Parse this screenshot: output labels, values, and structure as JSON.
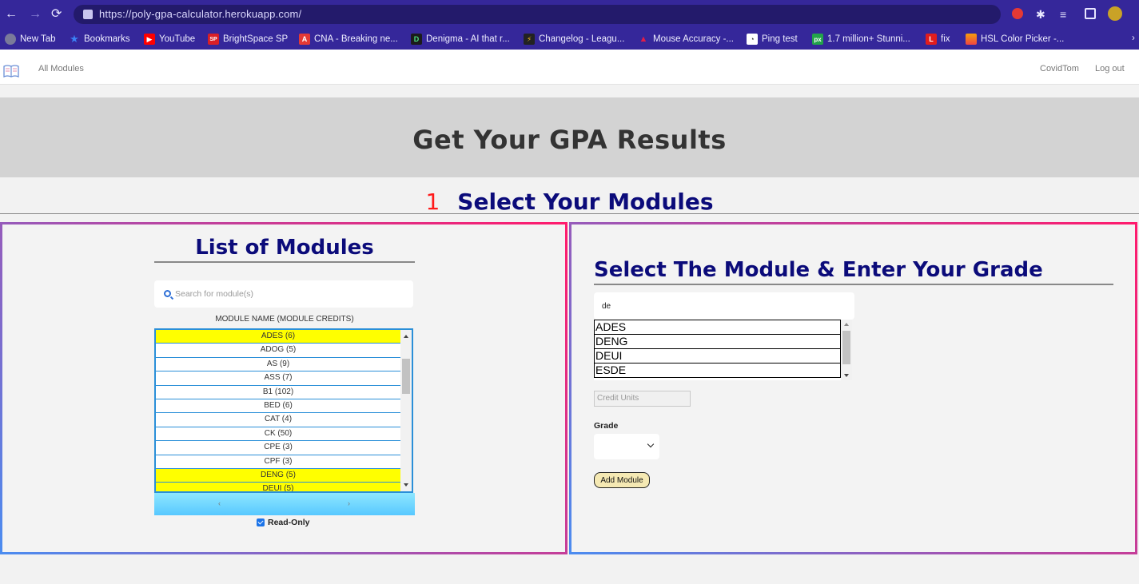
{
  "browser": {
    "url": "https://poly-gpa-calculator.herokuapp.com/",
    "bookmarks": [
      {
        "label": "New Tab",
        "color": "#7a7a9a",
        "glyph": ""
      },
      {
        "label": "Bookmarks",
        "color": "#3b82f6",
        "glyph": "★"
      },
      {
        "label": "YouTube",
        "color": "#ff0000",
        "glyph": "▶"
      },
      {
        "label": "BrightSpace SP",
        "color": "#d81f26",
        "glyph": "SP"
      },
      {
        "label": "CNA - Breaking ne...",
        "color": "#e53935",
        "glyph": "A"
      },
      {
        "label": "Denigma - AI that r...",
        "color": "#1b1b1b",
        "glyph": "D"
      },
      {
        "label": "Changelog - Leagu...",
        "color": "#222222",
        "glyph": "⚡"
      },
      {
        "label": "Mouse Accuracy -...",
        "color": "#e11d48",
        "glyph": "▲"
      },
      {
        "label": "Ping test",
        "color": "#ffffff",
        "glyph": "◔"
      },
      {
        "label": "1.7 million+ Stunni...",
        "color": "#22a34a",
        "glyph": "px"
      },
      {
        "label": "fix",
        "color": "#e11d1d",
        "glyph": "L"
      },
      {
        "label": "HSL Color Picker -...",
        "color": "#f59e0b",
        "glyph": "■"
      }
    ]
  },
  "nav": {
    "all_modules": "All Modules",
    "user": "CovidTom",
    "logout": "Log out"
  },
  "banner": {
    "title": "Get Your GPA Results"
  },
  "step": {
    "number": "1",
    "title": "Select Your Modules"
  },
  "modules_panel": {
    "title": "List of Modules",
    "search_placeholder": "Search for module(s)",
    "column_header": "MODULE NAME (MODULE CREDITS)",
    "items": [
      {
        "label": "ADES (6)",
        "highlighted": true
      },
      {
        "label": "ADOG (5)",
        "highlighted": false
      },
      {
        "label": "AS (9)",
        "highlighted": false
      },
      {
        "label": "ASS (7)",
        "highlighted": false
      },
      {
        "label": "B1 (102)",
        "highlighted": false
      },
      {
        "label": "BED (6)",
        "highlighted": false
      },
      {
        "label": "CAT (4)",
        "highlighted": false
      },
      {
        "label": "CK (50)",
        "highlighted": false
      },
      {
        "label": "CPE (3)",
        "highlighted": false
      },
      {
        "label": "CPF (3)",
        "highlighted": false
      },
      {
        "label": "DENG (5)",
        "highlighted": true
      },
      {
        "label": "DEUI (5)",
        "highlighted": true
      }
    ],
    "scroll_left": "‹",
    "scroll_right": "›",
    "readonly_label": "Read-Only",
    "readonly_checked": true
  },
  "select_panel": {
    "title": "Select The Module & Enter Your Grade",
    "filter_value": "de",
    "options": [
      "ADES",
      "DENG",
      "DEUI",
      "ESDE"
    ],
    "credit_placeholder": "Credit Units",
    "grade_label": "Grade",
    "grade_value": "",
    "add_button": "Add Module"
  },
  "colors": {
    "heading": "#0b0b7a",
    "step_number": "#ff1a1a",
    "highlight": "#ffff00",
    "list_border": "#2a8fd8",
    "browser_bar": "#35279a"
  }
}
